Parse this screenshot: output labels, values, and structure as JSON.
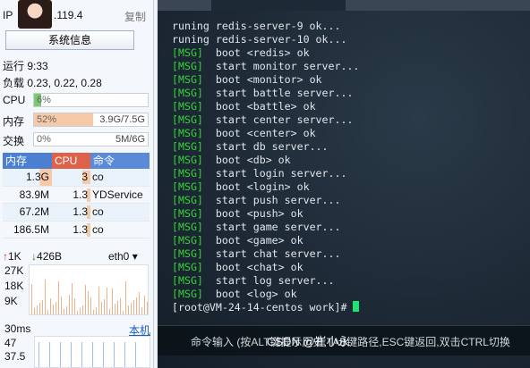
{
  "header": {
    "ip_label": "IP",
    "ip_value": ".119.4",
    "copy_label": "复制",
    "sysinfo_button": "系统信息"
  },
  "system": {
    "uptime": "运行 9:33",
    "load": "负载 0.23, 0.22, 0.28",
    "cpu": {
      "label": "CPU",
      "value": "6%",
      "percent": 6
    },
    "mem": {
      "label": "内存",
      "value": "52%",
      "percent": 52,
      "usage": "3.9G/7.5G"
    },
    "swap": {
      "label": "交换",
      "value": "0%",
      "percent": 0,
      "usage": "5M/6G"
    }
  },
  "process_table": {
    "headers": {
      "mem": "内存",
      "cpu": "CPU",
      "cmd": "命令"
    },
    "rows": [
      {
        "mem": "1.3G",
        "cpu": "3",
        "cmd": "co",
        "cpu_level": 0.3
      },
      {
        "mem": "83.9M",
        "cpu": "1.3",
        "cmd": "YDService",
        "cpu_level": 0.13
      },
      {
        "mem": "67.2M",
        "cpu": "1.3",
        "cmd": "co",
        "cpu_level": 0.13
      },
      {
        "mem": "186.5M",
        "cpu": "1.3",
        "cmd": "co",
        "cpu_level": 0.13
      }
    ]
  },
  "network": {
    "up_arrow": "↑",
    "up": "1K",
    "down_arrow": "↓",
    "down": "426B",
    "iface": "eth0",
    "axis": [
      "27K",
      "18K",
      "9K"
    ]
  },
  "latency": {
    "value": "30ms",
    "target": "本机",
    "axis": [
      "47",
      "37.5"
    ]
  },
  "terminal": {
    "lines": [
      {
        "tag": "",
        "text": "runing redis-server-9 ok..."
      },
      {
        "tag": "",
        "text": "runing redis-server-10 ok..."
      },
      {
        "tag": "[MSG]",
        "text": "  boot <redis> ok"
      },
      {
        "tag": "[MSG]",
        "text": "  start monitor server..."
      },
      {
        "tag": "[MSG]",
        "text": "  boot <monitor> ok"
      },
      {
        "tag": "[MSG]",
        "text": "  start battle server..."
      },
      {
        "tag": "[MSG]",
        "text": "  boot <battle> ok"
      },
      {
        "tag": "[MSG]",
        "text": "  start center server..."
      },
      {
        "tag": "[MSG]",
        "text": "  boot <center> ok"
      },
      {
        "tag": "[MSG]",
        "text": "  start db server..."
      },
      {
        "tag": "[MSG]",
        "text": "  boot <db> ok"
      },
      {
        "tag": "[MSG]",
        "text": "  start login server..."
      },
      {
        "tag": "[MSG]",
        "text": "  boot <login> ok"
      },
      {
        "tag": "[MSG]",
        "text": "  start push server..."
      },
      {
        "tag": "[MSG]",
        "text": "  boot <push> ok"
      },
      {
        "tag": "[MSG]",
        "text": "  start game server..."
      },
      {
        "tag": "[MSG]",
        "text": "  boot <game> ok"
      },
      {
        "tag": "[MSG]",
        "text": "  start chat server..."
      },
      {
        "tag": "[MSG]",
        "text": "  boot <chat> ok"
      },
      {
        "tag": "[MSG]",
        "text": "  start log server..."
      },
      {
        "tag": "[MSG]",
        "text": "  boot <log> ok"
      }
    ],
    "prompt": "[root@VM-24-14-centos work]# ",
    "input_hint": "命令输入 (按ALT键提示历史,TAB键路径,ESC键返回,双击CTRL切换"
  },
  "watermark": "CSDN @崔小永",
  "colors": {
    "cpu_fill": "#7bc96f",
    "mem_fill": "#f6c9a7",
    "header_mem": "#4b7fd1",
    "header_cpu": "#e0614a",
    "header_cmd": "#5a8ad8",
    "msg_green": "#37d437",
    "net_bar": "#f0b08a"
  }
}
